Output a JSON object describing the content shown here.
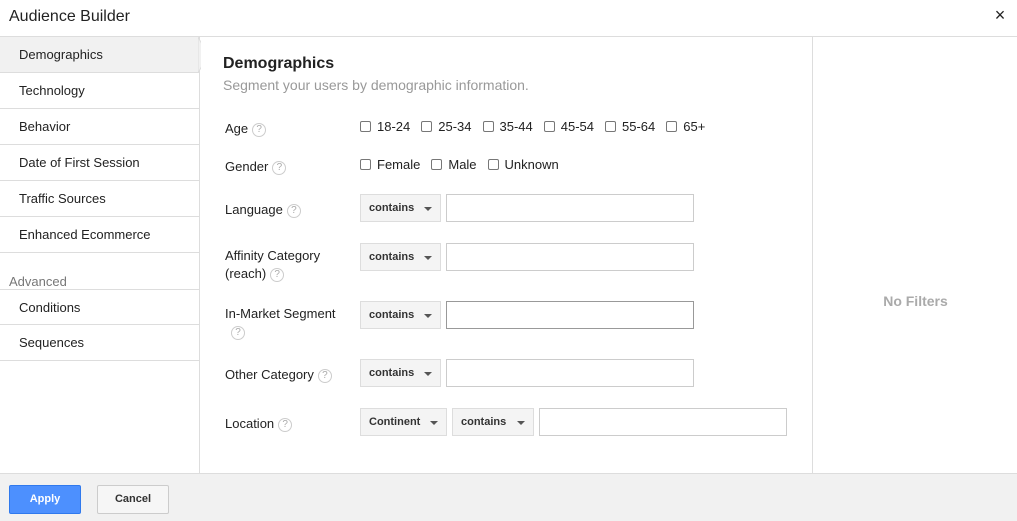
{
  "window": {
    "title": "Audience Builder",
    "close_icon": "×"
  },
  "sidebar": {
    "items": [
      {
        "label": "Demographics"
      },
      {
        "label": "Technology"
      },
      {
        "label": "Behavior"
      },
      {
        "label": "Date of First Session"
      },
      {
        "label": "Traffic Sources"
      },
      {
        "label": "Enhanced Ecommerce"
      }
    ],
    "advanced_label": "Advanced",
    "advanced_items": [
      {
        "label": "Conditions"
      },
      {
        "label": "Sequences"
      }
    ]
  },
  "main": {
    "title": "Demographics",
    "subtitle": "Segment your users by demographic information.",
    "help_glyph": "?",
    "age": {
      "label": "Age",
      "options": [
        "18-24",
        "25-34",
        "35-44",
        "45-54",
        "55-64",
        "65+"
      ]
    },
    "gender": {
      "label": "Gender",
      "options": [
        "Female",
        "Male",
        "Unknown"
      ]
    },
    "language": {
      "label": "Language",
      "operator": "contains",
      "value": ""
    },
    "affinity": {
      "label_line1": "Affinity Category",
      "label_line2": "(reach)",
      "operator": "contains",
      "value": ""
    },
    "in_market": {
      "label": "In-Market Segment",
      "operator": "contains",
      "value": ""
    },
    "other": {
      "label": "Other Category",
      "operator": "contains",
      "value": ""
    },
    "location": {
      "label": "Location",
      "scope": "Continent",
      "operator": "contains",
      "value": ""
    }
  },
  "summary": {
    "empty_text": "No Filters"
  },
  "footer": {
    "apply_label": "Apply",
    "cancel_label": "Cancel"
  },
  "colors": {
    "accent": "#4d90fe",
    "active_bg": "#f1f1f1",
    "border": "#dddddd"
  }
}
